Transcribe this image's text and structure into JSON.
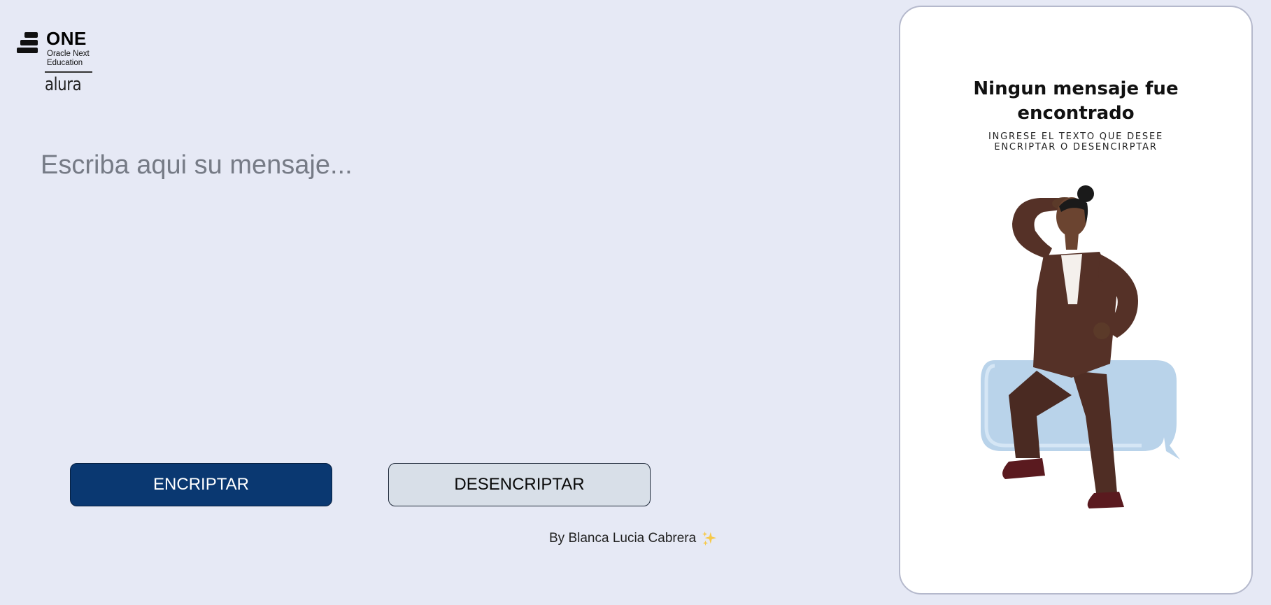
{
  "logo": {
    "brand": "ONE",
    "line1": "Oracle Next",
    "line2": "Education",
    "partner": "alura"
  },
  "input": {
    "placeholder": "Escriba aqui su mensaje...",
    "value": ""
  },
  "buttons": {
    "encrypt_label": "ENCRIPTAR",
    "decrypt_label": "DESENCRIPTAR"
  },
  "footer": {
    "credit": "By Blanca Lucia Cabrera",
    "icon": "sparkle-icon"
  },
  "result": {
    "title": "Ningun mensaje fue encontrado",
    "subtitle": "INGRESE EL TEXTO QUE DESEE ENCRIPTAR O DESENCIRPTAR",
    "illustration_icon": "woman-searching-illustration"
  },
  "colors": {
    "background": "#e6e9f5",
    "primary": "#0a3871",
    "secondary": "#d8dfe8",
    "panel": "#ffffff"
  }
}
